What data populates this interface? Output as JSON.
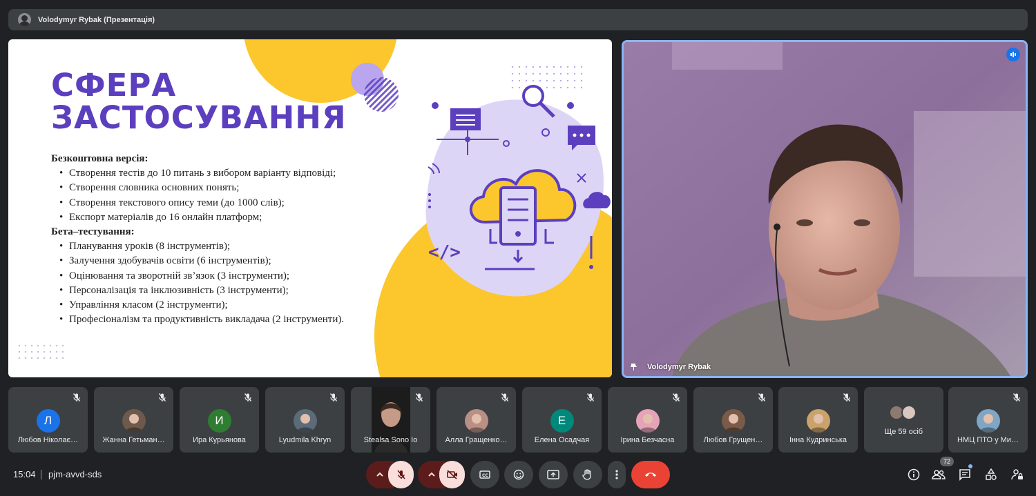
{
  "presenter_bar": {
    "title": "Volodymyr Rybak (Презентація)"
  },
  "slide": {
    "title_line1": "СФЕРА",
    "title_line2": "ЗАСТОСУВАННЯ",
    "free_heading": "Безкоштовна версія:",
    "free_items": [
      "Створення тестів до 10 питань з вибором варіанту відповіді;",
      "Створення словника основних понять;",
      "Створення текстового опису теми (до 1000 слів);",
      "Експорт матеріалів до 16 онлайн платформ;"
    ],
    "beta_heading": "Бета–тестування:",
    "beta_items": [
      "Планування уроків (8 інструментів);",
      "Залучення здобувачів освіти (6 інструментів);",
      "Оцінювання та зворотній зв’язок (3 інструменти);",
      "Персоналізація та інклюзивність (3 інструменти);",
      "Управління класом (2 інструменти);",
      "Професіоналізм та продуктивність викладача (2 інструменти)."
    ],
    "accent_color": "#5b3fbf",
    "yellow_color": "#fcc62d",
    "lilac_color": "#ddd5f5"
  },
  "speaker": {
    "name": "Volodymyr Rybak"
  },
  "participants": [
    {
      "name": "Любов Ніколає…",
      "initial": "Л",
      "color": "#1a73e8",
      "type": "initial"
    },
    {
      "name": "Жанна Гетьман…",
      "initial": "",
      "color": "#6d5a4c",
      "type": "photo"
    },
    {
      "name": "Ира Курьянова",
      "initial": "И",
      "color": "#2e7d32",
      "type": "initial"
    },
    {
      "name": "Lyudmila Khryn",
      "initial": "",
      "color": "#5c6b78",
      "type": "photo"
    },
    {
      "name": "Stealsa Sono Io",
      "initial": "",
      "color": "#2a2a2a",
      "type": "video"
    },
    {
      "name": "Алла Гращенко…",
      "initial": "",
      "color": "#b98f86",
      "type": "photo"
    },
    {
      "name": "Елена Осадчая",
      "initial": "Е",
      "color": "#00897b",
      "type": "initial"
    },
    {
      "name": "Ірина Безчасна",
      "initial": "",
      "color": "#e6a3b7",
      "type": "photo"
    },
    {
      "name": "Любов Грущен…",
      "initial": "",
      "color": "#7a5a48",
      "type": "photo"
    },
    {
      "name": "Інна Кудринська",
      "initial": "",
      "color": "#c9a36a",
      "type": "photo"
    },
    {
      "name": "Ще 59 осіб",
      "initial": "",
      "color": "",
      "type": "more"
    },
    {
      "name": "НМЦ ПТО у Ми…",
      "initial": "",
      "color": "#7fa6c4",
      "type": "photo"
    }
  ],
  "bottom_bar": {
    "time": "15:04",
    "meeting_code": "pjm-avvd-sds",
    "people_count": "72"
  },
  "colors": {
    "bg": "#202124",
    "tile": "#3c4043",
    "muted_red": "#5c1c1c",
    "muted_pink": "#f9dedc",
    "end_call": "#ea4335",
    "speaking_border": "#8ab4f8"
  }
}
